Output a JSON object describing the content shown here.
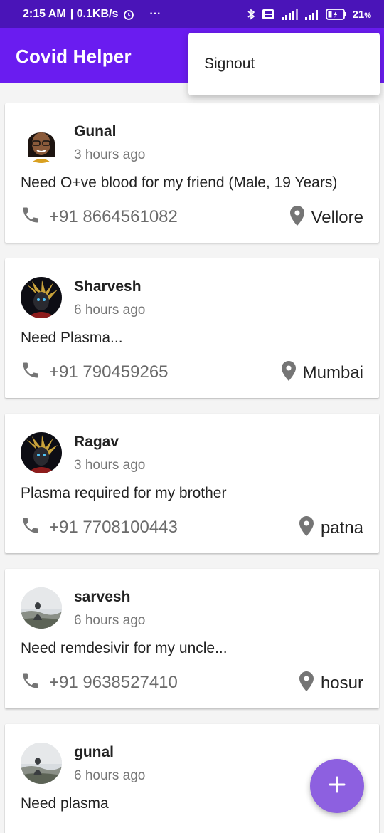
{
  "status_bar": {
    "time": "2:15 AM",
    "network_speed": "| 0.1KB/s",
    "more": "···",
    "battery": "21",
    "battery_unit": "%",
    "icons": [
      "alarm-icon",
      "bluetooth-icon",
      "volte-icon",
      "signal-icon",
      "battery-icon"
    ]
  },
  "app_bar": {
    "title": "Covid Helper"
  },
  "menu": {
    "items": [
      {
        "label": "Signout"
      }
    ]
  },
  "posts": [
    {
      "name": "Gunal",
      "time": "3 hours ago",
      "message": "Need O+ve blood for my friend (Male, 19 Years)",
      "phone": "+91 8664561082",
      "location": "Vellore",
      "avatar": "emoji-avatar"
    },
    {
      "name": "Sharvesh",
      "time": "6 hours ago",
      "message": "Need Plasma...",
      "phone": "+91 790459265",
      "location": "Mumbai",
      "avatar": "dark-hero-avatar"
    },
    {
      "name": "Ragav",
      "time": "3 hours ago",
      "message": "Plasma required for my brother",
      "phone": "+91 7708100443",
      "location": "patna",
      "avatar": "dark-hero-avatar"
    },
    {
      "name": "sarvesh",
      "time": "6 hours ago",
      "message": "Need remdesivir for my uncle...",
      "phone": "+91 9638527410",
      "location": "hosur",
      "avatar": "landscape-avatar"
    },
    {
      "name": "gunal",
      "time": "6 hours ago",
      "message": "Need plasma",
      "phone": "",
      "location": "",
      "avatar": "landscape-avatar"
    }
  ],
  "fab": {
    "icon": "plus-icon"
  },
  "colors": {
    "status_bar": "#4a14b8",
    "app_bar": "#6a1cf0",
    "fab": "#8d60e0",
    "icon_gray": "#757575"
  }
}
